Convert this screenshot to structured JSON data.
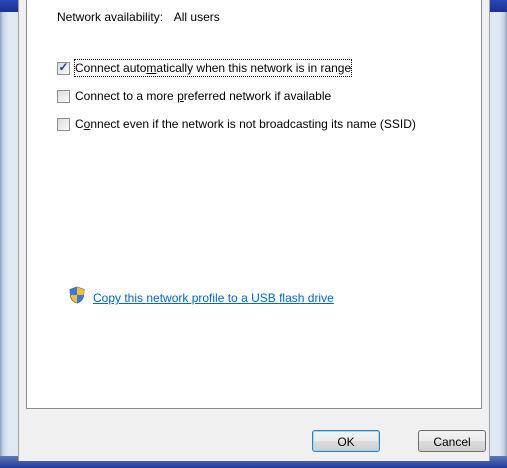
{
  "network_availability": {
    "label": "Network availability:",
    "value": "All users"
  },
  "options": [
    {
      "pre": "Connect auto",
      "accel": "m",
      "post": "atically when this network is in range",
      "checked": true
    },
    {
      "pre": "Connect to a more ",
      "accel": "p",
      "post": "referred network if available",
      "checked": false
    },
    {
      "pre": "C",
      "accel": "o",
      "post": "nnect even if the network is not broadcasting its name (SSID)",
      "checked": false
    }
  ],
  "copy_link": {
    "text": "Copy this network profile to a USB flash drive",
    "icon": "shield-icon"
  },
  "buttons": {
    "ok": "OK",
    "cancel": "Cancel"
  }
}
